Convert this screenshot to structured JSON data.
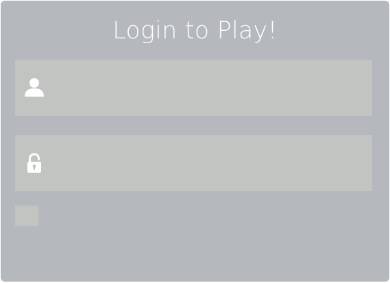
{
  "login": {
    "title": "Login to Play!",
    "username": {
      "icon": "user-icon",
      "value": "",
      "placeholder": ""
    },
    "password": {
      "icon": "lock-icon",
      "value": "",
      "placeholder": ""
    },
    "remember_checkbox": {
      "checked": false
    }
  },
  "colors": {
    "panel": "#b5b8bc",
    "field": "#c2c4c2",
    "text": "#ffffff"
  }
}
